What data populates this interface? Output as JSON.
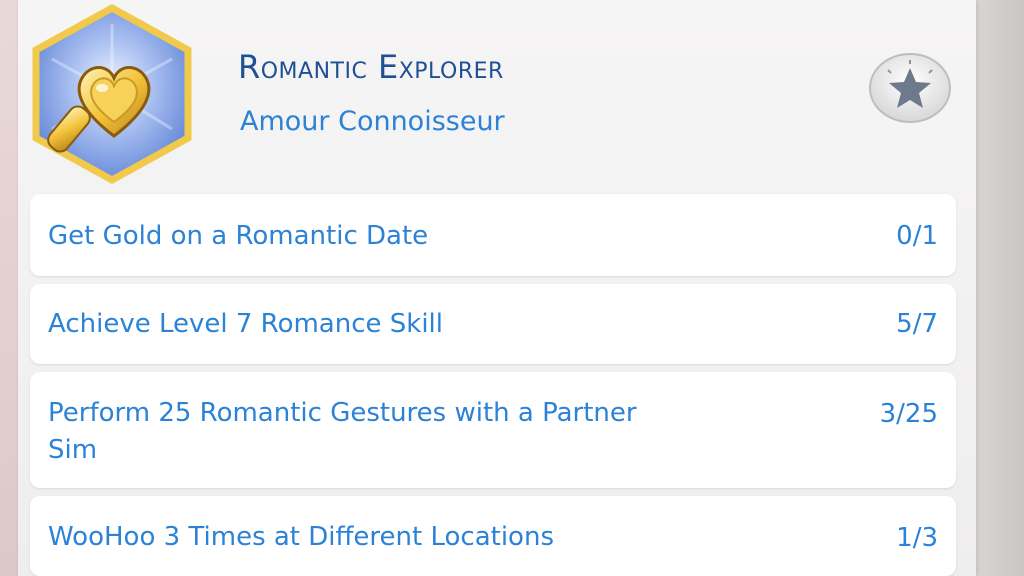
{
  "header": {
    "title": "Romantic Explorer",
    "subtitle": "Amour Connoisseur",
    "badge_icon": "heart-magnifying-glass-icon",
    "star_icon": "star-icon"
  },
  "tasks": [
    {
      "label": "Get Gold on a Romantic Date",
      "progress": "0/1"
    },
    {
      "label": "Achieve Level 7 Romance Skill",
      "progress": "5/7"
    },
    {
      "label": "Perform 25 Romantic Gestures with a Partner Sim",
      "progress": "3/25"
    },
    {
      "label": "WooHoo 3 Times at Different Locations",
      "progress": "1/3"
    }
  ],
  "colors": {
    "title": "#1f4f94",
    "text": "#2b82d6",
    "badge_border": "#f0c84a",
    "badge_fill": "#7a9be0"
  }
}
